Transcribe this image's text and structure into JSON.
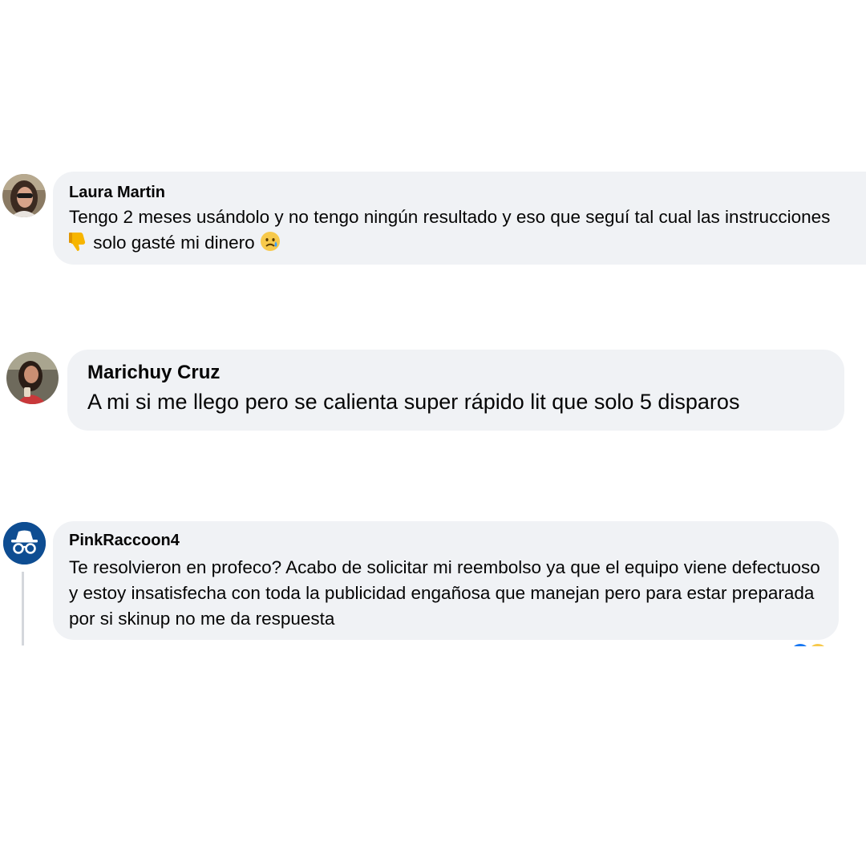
{
  "comments": [
    {
      "author": "Laura Martin",
      "text_before_emoji": "Tengo 2 meses usándolo y no tengo ningún resultado y eso que seguí tal cual las instrucciones ",
      "emoji_1": "thumbs-down",
      "text_middle": " solo gasté mi dinero ",
      "emoji_2": "sad-tear-face"
    },
    {
      "author": "Marichuy Cruz",
      "text": "A mi si me llego pero se calienta super rápido lit que solo 5 disparos"
    },
    {
      "author": "PinkRaccoon4",
      "avatar_icon": "incognito-icon",
      "text": "Te resolvieron en profeco? Acabo de solicitar mi reembolso ya que el equipo viene defectuoso y estoy insatisfecha con toda la publicidad engañosa que manejan pero para estar preparada por si skinup no me da respuesta"
    }
  ],
  "colors": {
    "bubble": "#f0f2f5",
    "text": "#050505",
    "anon_avatar": "#0e4d92",
    "like": "#1877f2",
    "haha": "#f7c94b"
  }
}
